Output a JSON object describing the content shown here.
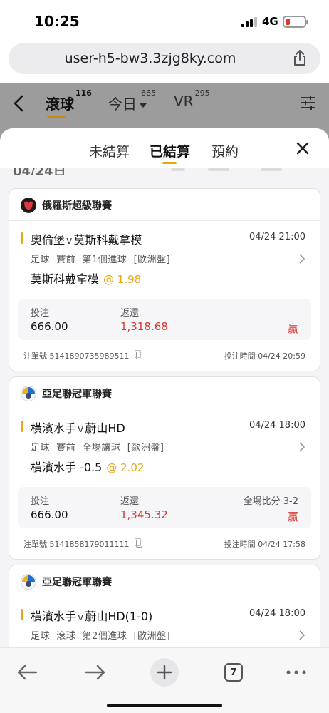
{
  "status_bar": {
    "time": "10:25",
    "network": "4G"
  },
  "browser": {
    "url": "user-h5-bw3.3zjg8ky.com",
    "tab_count": "7"
  },
  "page_header": {
    "tabs": [
      {
        "label": "滾球",
        "count": "116"
      },
      {
        "label": "今日",
        "count": "665"
      },
      {
        "label": "VR",
        "count": "295"
      }
    ]
  },
  "sheet": {
    "tabs": [
      "未結算",
      "已結算",
      "預約"
    ],
    "active_tab": "已結算",
    "date_peek": "04/24日"
  },
  "labels": {
    "stake": "投注",
    "return": "返還",
    "order_no": "注單號",
    "bet_time": "投注時間"
  },
  "bets": [
    {
      "league": "俄羅斯超級聯賽",
      "home": "奧倫堡",
      "vs": "v",
      "away": "莫斯科戴拿模",
      "match_time": "04/24 21:00",
      "market": "足球  賽前  第1個進球  [歐洲盤]",
      "selection": "莫斯科戴拿模",
      "odds": "@ 1.98",
      "stake": "666.00",
      "return": "1,318.68",
      "result": "贏",
      "score": "",
      "order_no": "5141890735989511",
      "bet_time": "04/24 20:59"
    },
    {
      "league": "亞足聯冠軍聯賽",
      "home": "橫濱水手",
      "vs": "v",
      "away": "蔚山HD",
      "match_time": "04/24 18:00",
      "market": "足球  賽前  全場讓球  [歐洲盤]",
      "selection": "橫濱水手 -0.5",
      "odds": "@ 2.02",
      "stake": "666.00",
      "return": "1,345.32",
      "result": "贏",
      "score": "全場比分 3-2",
      "order_no": "5141858179011111",
      "bet_time": "04/24 17:58"
    },
    {
      "league": "亞足聯冠軍聯賽",
      "home": "橫濱水手",
      "vs": "v",
      "away": "蔚山HD(1-0)",
      "match_time": "04/24 18:00",
      "market": "足球  滾球  第2個進球  [歐洲盤]"
    }
  ],
  "colors": {
    "accent": "#e8a712",
    "win": "#d43b33",
    "overlay": "#9c9c9c"
  }
}
